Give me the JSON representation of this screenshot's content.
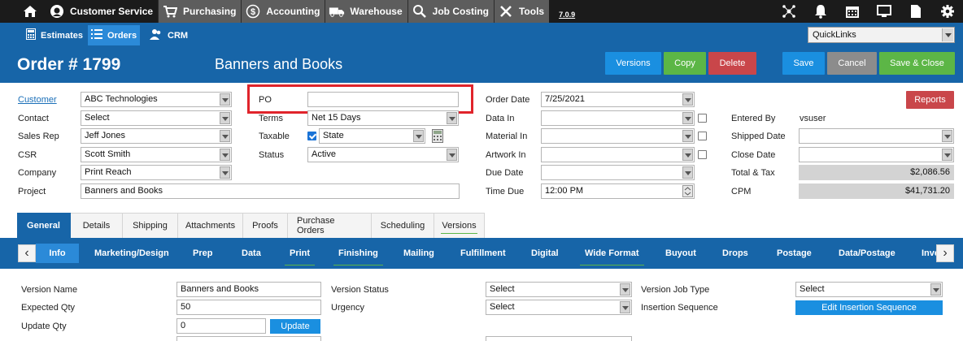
{
  "topnav": {
    "items": [
      {
        "label": "Customer Service",
        "icon": "headset-icon"
      },
      {
        "label": "Purchasing",
        "icon": "cart-icon"
      },
      {
        "label": "Accounting",
        "icon": "dollar-icon"
      },
      {
        "label": "Warehouse",
        "icon": "truck-icon"
      },
      {
        "label": "Job Costing",
        "icon": "search-icon"
      },
      {
        "label": "Tools",
        "icon": "tools-icon"
      }
    ],
    "version": "7.0.9"
  },
  "subnav": {
    "items": [
      {
        "label": "Estimates",
        "icon": "calculator-icon"
      },
      {
        "label": "Orders",
        "icon": "list-icon"
      },
      {
        "label": "CRM",
        "icon": "users-icon"
      }
    ],
    "quicklinks": "QuickLinks"
  },
  "header": {
    "order_number": "Order # 1799",
    "order_name": "Banners and Books",
    "buttons": {
      "versions": "Versions",
      "copy": "Copy",
      "delete": "Delete",
      "save": "Save",
      "cancel": "Cancel",
      "save_close": "Save & Close"
    }
  },
  "form": {
    "customer": {
      "label": "Customer",
      "value": "ABC Technologies"
    },
    "contact": {
      "label": "Contact",
      "value": "Select"
    },
    "sales_rep": {
      "label": "Sales Rep",
      "value": "Jeff Jones"
    },
    "csr": {
      "label": "CSR",
      "value": "Scott Smith"
    },
    "company": {
      "label": "Company",
      "value": "Print Reach"
    },
    "project": {
      "label": "Project",
      "value": "Banners and Books"
    },
    "po": {
      "label": "PO",
      "value": ""
    },
    "terms": {
      "label": "Terms",
      "value": "Net 15 Days"
    },
    "taxable": {
      "label": "Taxable",
      "value": "State"
    },
    "status": {
      "label": "Status",
      "value": "Active"
    },
    "order_date": {
      "label": "Order Date",
      "value": "7/25/2021"
    },
    "data_in": {
      "label": "Data In",
      "value": ""
    },
    "material_in": {
      "label": "Material In",
      "value": ""
    },
    "artwork_in": {
      "label": "Artwork In",
      "value": ""
    },
    "due_date": {
      "label": "Due Date",
      "value": ""
    },
    "time_due": {
      "label": "Time Due",
      "value": "12:00 PM"
    },
    "reports": "Reports",
    "entered_by": {
      "label": "Entered By",
      "value": "vsuser"
    },
    "shipped_date": {
      "label": "Shipped Date",
      "value": ""
    },
    "close_date": {
      "label": "Close Date",
      "value": ""
    },
    "total_tax": {
      "label": "Total & Tax",
      "value": "$2,086.56"
    },
    "cpm": {
      "label": "CPM",
      "value": "$41,731.20"
    }
  },
  "tabs": [
    "General",
    "Details",
    "Shipping",
    "Attachments",
    "Proofs",
    "Purchase Orders",
    "Scheduling",
    "Versions"
  ],
  "subtabs": [
    "Info",
    "Marketing/Design",
    "Prep",
    "Data",
    "Print",
    "Finishing",
    "Mailing",
    "Fulfillment",
    "Digital",
    "Wide Format",
    "Buyout",
    "Drops",
    "Postage",
    "Data/Postage",
    "Inve"
  ],
  "version_panel": {
    "version_name": {
      "label": "Version Name",
      "value": "Banners and Books"
    },
    "expected_qty": {
      "label": "Expected Qty",
      "value": "50"
    },
    "update_qty": {
      "label": "Update Qty",
      "value": "0"
    },
    "update_button": "Update",
    "version_status": {
      "label": "Version Status",
      "value": "Select"
    },
    "urgency": {
      "label": "Urgency",
      "value": "Select"
    },
    "version_job_type": {
      "label": "Version Job Type",
      "value": "Select"
    },
    "insertion_sequence": {
      "label": "Insertion Sequence",
      "button": "Edit Insertion Sequence"
    }
  }
}
